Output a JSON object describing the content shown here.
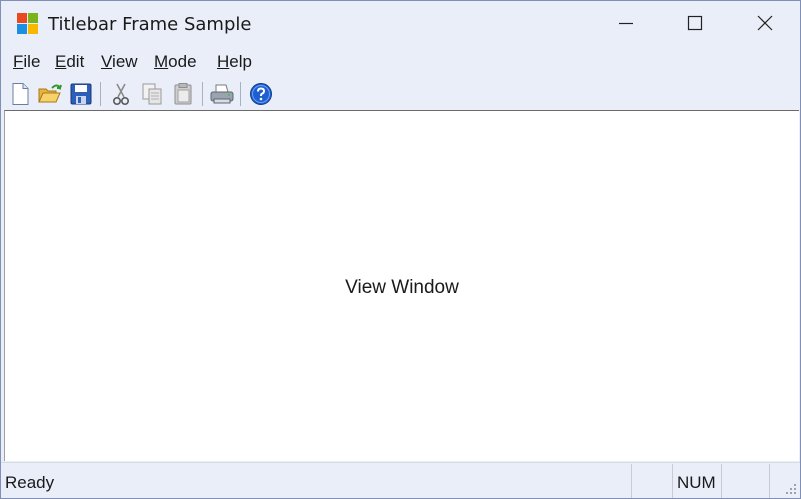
{
  "window": {
    "title": "Titlebar Frame Sample"
  },
  "menu": {
    "items": [
      {
        "label_underlined": "F",
        "label_rest": "ile"
      },
      {
        "label_underlined": "E",
        "label_rest": "dit"
      },
      {
        "label_underlined": "V",
        "label_rest": "iew"
      },
      {
        "label_underlined": "M",
        "label_rest": "ode"
      },
      {
        "label_underlined": "H",
        "label_rest": "elp"
      }
    ]
  },
  "toolbar": {
    "icons": [
      "new-file-icon",
      "open-folder-icon",
      "save-disk-icon",
      "cut-scissors-icon",
      "copy-icon",
      "paste-icon",
      "print-icon",
      "help-icon"
    ]
  },
  "view": {
    "text": "View Window"
  },
  "status": {
    "text": "Ready",
    "panes": [
      "",
      "NUM",
      ""
    ]
  },
  "colors": {
    "frame_bg": "#eaeef9",
    "view_bg": "#ffffff",
    "help_blue": "#1e5fcf"
  }
}
